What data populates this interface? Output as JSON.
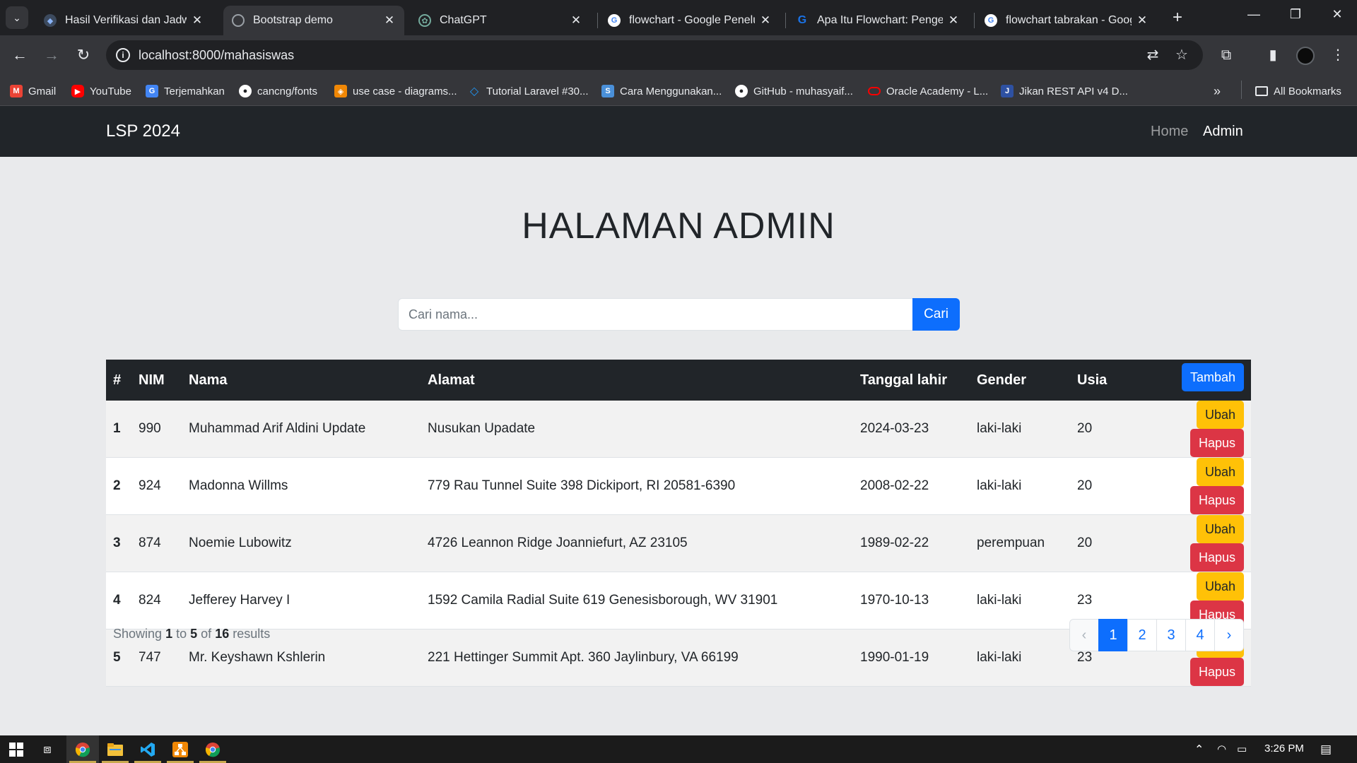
{
  "browser": {
    "tabs": [
      {
        "title": "Hasil Verifikasi dan Jadwal",
        "favicon_color": "#3c4a5e",
        "icon": "custom-site-icon"
      },
      {
        "title": "Bootstrap demo",
        "favicon_color": "#9aa0a6",
        "icon": "globe-icon",
        "active": true
      },
      {
        "title": "ChatGPT",
        "favicon_color": "#74aa9c",
        "icon": "chatgpt-icon"
      },
      {
        "title": "flowchart - Google Penelusuran",
        "favicon_color": "#ffffff",
        "icon": "google-icon"
      },
      {
        "title": "Apa Itu Flowchart: Pengertian",
        "favicon_color": "#1a73e8",
        "icon": "site-g-icon"
      },
      {
        "title": "flowchart tabrakan - Google",
        "favicon_color": "#ffffff",
        "icon": "google-icon"
      }
    ],
    "url": "localhost:8000/mahasiswas",
    "bookmarks": [
      {
        "label": "Gmail",
        "color": "#ea4335",
        "icon": "gmail-icon"
      },
      {
        "label": "YouTube",
        "color": "#ff0000",
        "icon": "youtube-icon"
      },
      {
        "label": "Terjemahkan",
        "color": "#4285f4",
        "icon": "translate-icon"
      },
      {
        "label": "cancng/fonts",
        "color": "#ffffff",
        "icon": "github-icon"
      },
      {
        "label": "use case - diagrams...",
        "color": "#f08705",
        "icon": "drawio-icon"
      },
      {
        "label": "Tutorial Laravel #30...",
        "color": "#2196f3",
        "icon": "code-icon"
      },
      {
        "label": "Cara Menggunakan...",
        "color": "#4a90d9",
        "icon": "s-site-icon"
      },
      {
        "label": "GitHub - muhasyaif...",
        "color": "#ffffff",
        "icon": "github-icon"
      },
      {
        "label": "Oracle Academy - L...",
        "color": "#f80000",
        "icon": "oracle-icon"
      },
      {
        "label": "Jikan REST API v4 D...",
        "color": "#2e51a2",
        "icon": "jikan-icon"
      }
    ],
    "all_bookmarks": "All Bookmarks"
  },
  "navbar": {
    "brand": "LSP 2024",
    "links": [
      "Home",
      "Admin"
    ],
    "active": "Admin"
  },
  "page": {
    "title": "HALAMAN ADMIN"
  },
  "search": {
    "placeholder": "Cari nama...",
    "button": "Cari"
  },
  "table": {
    "headers": [
      "#",
      "NIM",
      "Nama",
      "Alamat",
      "Tanggal lahir",
      "Gender",
      "Usia"
    ],
    "add_button": "Tambah",
    "edit_label": "Ubah",
    "delete_label": "Hapus",
    "rows": [
      {
        "no": "1",
        "nim": "990",
        "nama": "Muhammad Arif Aldini Update",
        "alamat": "Nusukan Upadate",
        "tanggal_lahir": "2024-03-23",
        "gender": "laki-laki",
        "usia": "20"
      },
      {
        "no": "2",
        "nim": "924",
        "nama": "Madonna Willms",
        "alamat": "779 Rau Tunnel Suite 398 Dickiport, RI 20581-6390",
        "tanggal_lahir": "2008-02-22",
        "gender": "laki-laki",
        "usia": "20"
      },
      {
        "no": "3",
        "nim": "874",
        "nama": "Noemie Lubowitz",
        "alamat": "4726 Leannon Ridge Joanniefurt, AZ 23105",
        "tanggal_lahir": "1989-02-22",
        "gender": "perempuan",
        "usia": "20"
      },
      {
        "no": "4",
        "nim": "824",
        "nama": "Jefferey Harvey I",
        "alamat": "1592 Camila Radial Suite 619 Genesisborough, WV 31901",
        "tanggal_lahir": "1970-10-13",
        "gender": "laki-laki",
        "usia": "23"
      },
      {
        "no": "5",
        "nim": "747",
        "nama": "Mr. Keyshawn Kshlerin",
        "alamat": "221 Hettinger Summit Apt. 360 Jaylinbury, VA 66199",
        "tanggal_lahir": "1990-01-19",
        "gender": "laki-laki",
        "usia": "23"
      }
    ]
  },
  "pagination": {
    "showing_prefix": "Showing",
    "from": "1",
    "to_word": "to",
    "to": "5",
    "of_word": "of",
    "total": "16",
    "results_word": "results",
    "prev": "‹",
    "next": "›",
    "pages": [
      "1",
      "2",
      "3",
      "4"
    ],
    "current": "1"
  },
  "taskbar": {
    "time": "3:26 PM",
    "apps": [
      "start-icon",
      "task-view-icon",
      "chrome-icon",
      "file-explorer-icon",
      "vscode-icon",
      "drawio-icon",
      "chrome-icon"
    ]
  },
  "colors": {
    "navbar_bg": "#212529",
    "primary": "#0d6efd",
    "warning": "#ffc107",
    "danger": "#dc3545",
    "page_bg": "#e9eaec"
  }
}
